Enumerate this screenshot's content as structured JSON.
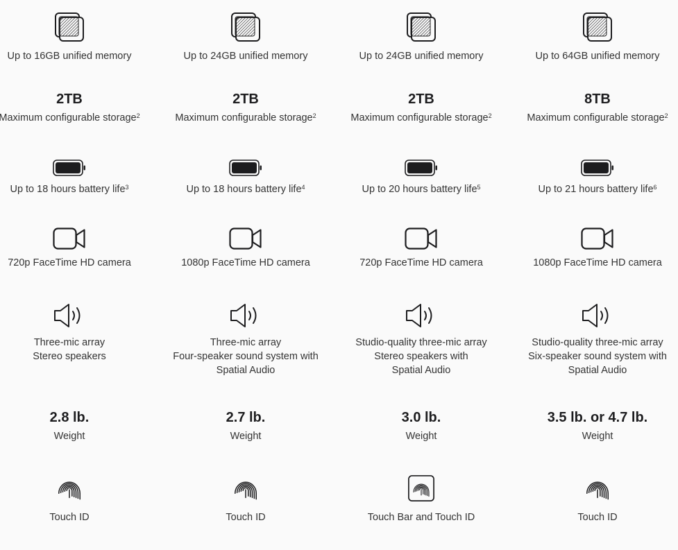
{
  "columns": [
    {
      "memory": "Up to 16GB unified memory",
      "storage_value": "2TB",
      "storage_label": "Maximum configurable storage",
      "storage_note": "2",
      "battery": "Up to 18 hours battery life",
      "battery_note": "3",
      "camera": "720p FaceTime HD camera",
      "audio_lines": [
        "Three-mic array",
        "Stereo speakers",
        ""
      ],
      "weight_value": "2.8 lb.",
      "weight_label": "Weight",
      "touch": "Touch ID",
      "touch_icon": "fingerprint-icon"
    },
    {
      "memory": "Up to 24GB unified memory",
      "storage_value": "2TB",
      "storage_label": "Maximum configurable storage",
      "storage_note": "2",
      "battery": "Up to 18 hours battery life",
      "battery_note": "4",
      "camera": "1080p FaceTime HD camera",
      "audio_lines": [
        "Three-mic array",
        "Four-speaker sound system with",
        "Spatial Audio"
      ],
      "weight_value": "2.7 lb.",
      "weight_label": "Weight",
      "touch": "Touch ID",
      "touch_icon": "fingerprint-icon"
    },
    {
      "memory": "Up to 24GB unified memory",
      "storage_value": "2TB",
      "storage_label": "Maximum configurable storage",
      "storage_note": "2",
      "battery": "Up to 20 hours battery life",
      "battery_note": "5",
      "camera": "720p FaceTime HD camera",
      "audio_lines": [
        "Studio-quality three-mic array",
        "Stereo speakers with",
        "Spatial Audio"
      ],
      "weight_value": "3.0 lb.",
      "weight_label": "Weight",
      "touch": "Touch Bar and Touch ID",
      "touch_icon": "touch-bar-fingerprint-icon"
    },
    {
      "memory": "Up to 64GB unified memory",
      "storage_value": "8TB",
      "storage_label": "Maximum configurable storage",
      "storage_note": "2",
      "battery": "Up to 21 hours battery life",
      "battery_note": "6",
      "camera": "1080p FaceTime HD camera",
      "audio_lines": [
        "Studio-quality three-mic array",
        "Six-speaker sound system with",
        "Spatial Audio"
      ],
      "weight_value": "3.5 lb. or 4.7 lb.",
      "weight_label": "Weight",
      "touch": "Touch ID",
      "touch_icon": "fingerprint-icon"
    }
  ]
}
